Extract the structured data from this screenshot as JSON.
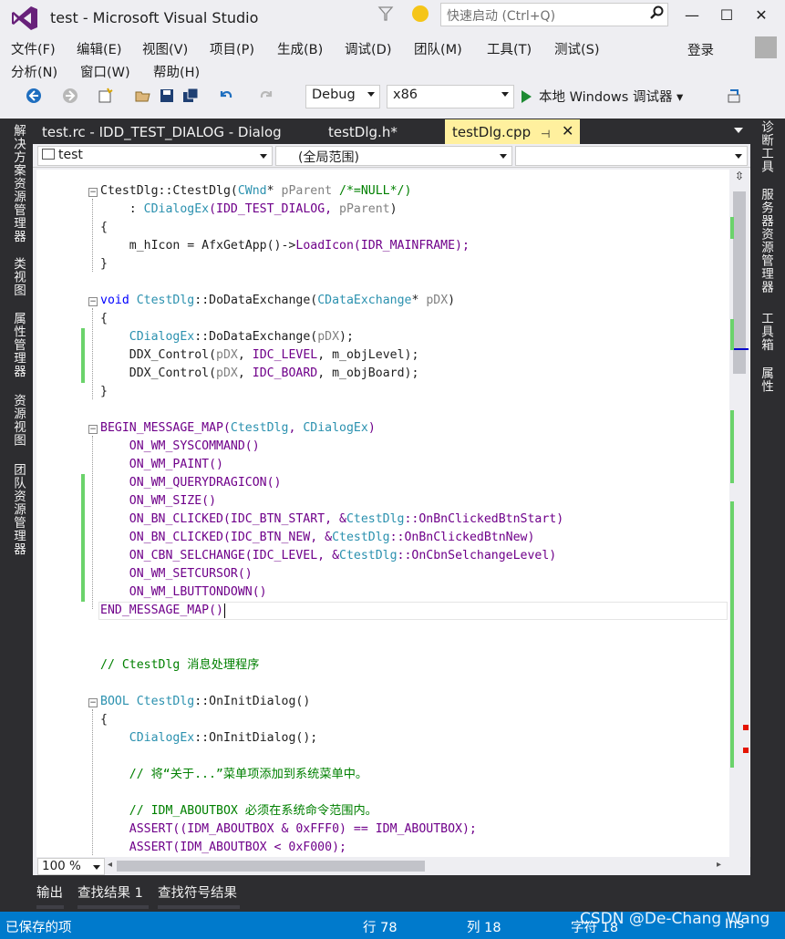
{
  "window": {
    "title": "test - Microsoft Visual Studio",
    "quick_launch_placeholder": "快速启动 (Ctrl+Q)",
    "login": "登录"
  },
  "menu_row1": [
    "文件(F)",
    "编辑(E)",
    "视图(V)",
    "项目(P)",
    "生成(B)",
    "调试(D)",
    "团队(M)",
    "工具(T)",
    "测试(S)"
  ],
  "menu_row2": [
    "分析(N)",
    "窗口(W)",
    "帮助(H)"
  ],
  "toolbar": {
    "config": "Debug",
    "platform": "x86",
    "run_label": "本地 Windows 调试器"
  },
  "left_dock_tabs": [
    "解决方案资源管理器",
    "类视图",
    "属性管理器",
    "资源视图",
    "团队资源管理器"
  ],
  "right_dock_tabs": [
    "诊断工具",
    "服务器资源管理器",
    "工具箱",
    "属性"
  ],
  "doc_tabs": {
    "tab1": "test.rc - IDD_TEST_DIALOG - Dialog",
    "tab2": "testDlg.h*",
    "active": "testDlg.cpp"
  },
  "navbar": {
    "project": "test",
    "scope": "(全局范围)",
    "member": ""
  },
  "code": {
    "l1a": "CtestDlg::CtestDlg(",
    "l1b": "CWnd",
    "l1c": "* ",
    "l1d": "pParent",
    "l1e": " /*=NULL*/)",
    "l2a": "    : ",
    "l2b": "CDialogEx",
    "l2c": "(IDD_TEST_DIALOG, ",
    "l2d": "pParent",
    "l2e": ")",
    "l3": "{",
    "l4a": "    m_hIcon = AfxGetApp()->",
    "l4b": "LoadIcon",
    "l4c": "(IDR_MAINFRAME);",
    "l5": "}",
    "l6a": "void",
    "l6b": " ",
    "l6c": "CtestDlg",
    "l6d": "::DoDataExchange(",
    "l6e": "CDataExchange",
    "l6f": "* ",
    "l6g": "pDX",
    "l6h": ")",
    "l7": "{",
    "l8a": "    ",
    "l8b": "CDialogEx",
    "l8c": "::DoDataExchange(",
    "l8d": "pDX",
    "l8e": ");",
    "l9a": "    DDX_Control(",
    "l9b": "pDX",
    "l9c": ", ",
    "l9d": "IDC_LEVEL",
    "l9e": ", m_objLevel);",
    "l10a": "    DDX_Control(",
    "l10b": "pDX",
    "l10c": ", ",
    "l10d": "IDC_BOARD",
    "l10e": ", m_objBoard);",
    "l11": "}",
    "l12a": "BEGIN_MESSAGE_MAP(",
    "l12b": "CtestDlg",
    "l12c": ", ",
    "l12d": "CDialogEx",
    "l12e": ")",
    "l13": "    ON_WM_SYSCOMMAND()",
    "l14": "    ON_WM_PAINT()",
    "l15": "    ON_WM_QUERYDRAGICON()",
    "l16": "    ON_WM_SIZE()",
    "l17a": "    ON_BN_CLICKED(IDC_BTN_START, &",
    "l17b": "CtestDlg",
    "l17c": "::OnBnClickedBtnStart)",
    "l18a": "    ON_BN_CLICKED(IDC_BTN_NEW, &",
    "l18b": "CtestDlg",
    "l18c": "::OnBnClickedBtnNew)",
    "l19a": "    ON_CBN_SELCHANGE(IDC_LEVEL, &",
    "l19b": "CtestDlg",
    "l19c": "::OnCbnSelchangeLevel)",
    "l20": "    ON_WM_SETCURSOR()",
    "l21": "    ON_WM_LBUTTONDOWN()",
    "l22": "END_MESSAGE_MAP()",
    "l23": "// CtestDlg 消息处理程序",
    "l24a": "BOOL",
    "l24b": " ",
    "l24c": "CtestDlg",
    "l24d": "::OnInitDialog()",
    "l25": "{",
    "l26a": "    ",
    "l26b": "CDialogEx",
    "l26c": "::OnInitDialog();",
    "l27": "    // 将“关于...”菜单项添加到系统菜单中。",
    "l28": "    // IDM_ABOUTBOX 必须在系统命令范围内。",
    "l29": "    ASSERT((IDM_ABOUTBOX & 0xFFF0) == IDM_ABOUTBOX);",
    "l30": "    ASSERT(IDM_ABOUTBOX < 0xF000);"
  },
  "zoom": "100 %",
  "bottom_tabs": [
    "输出",
    "查找结果 1",
    "查找符号结果"
  ],
  "status": {
    "message": "已保存的项",
    "line": "行 78",
    "col": "列 18",
    "char": "字符 18",
    "mode": "Ins"
  },
  "watermark": "CSDN @De-Chang Wang"
}
